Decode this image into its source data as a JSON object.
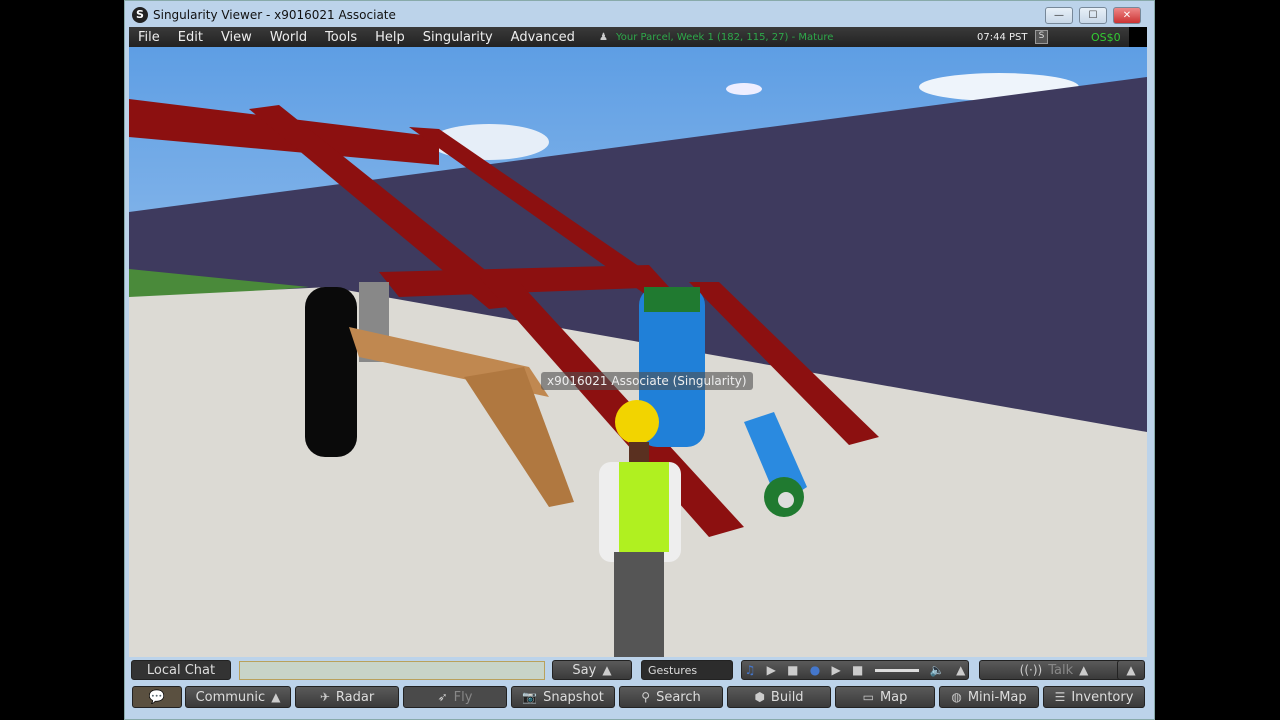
{
  "window": {
    "title": "Singularity Viewer - x9016021 Associate",
    "logo": "S",
    "min": "—",
    "max": "☐",
    "close": "✕"
  },
  "menu": [
    "File",
    "Edit",
    "View",
    "World",
    "Tools",
    "Help",
    "Singularity",
    "Advanced"
  ],
  "status": {
    "parcel": "Your Parcel, Week 1 (182, 115, 27) - Mature",
    "time": "07:44 PST",
    "linden_icon": "S",
    "balance": "OS$0"
  },
  "scene": {
    "name_tag": "x9016021 Associate (Singularity)"
  },
  "chatbar": {
    "local_chat": "Local Chat",
    "chat_value": "",
    "say": "Say",
    "gestures": "Gestures",
    "talk": "Talk"
  },
  "toolbar": {
    "communicate": "Communic",
    "radar": "Radar",
    "fly": "Fly",
    "snapshot": "Snapshot",
    "search": "Search",
    "build": "Build",
    "map": "Map",
    "minimap": "Mini-Map",
    "inventory": "Inventory"
  }
}
